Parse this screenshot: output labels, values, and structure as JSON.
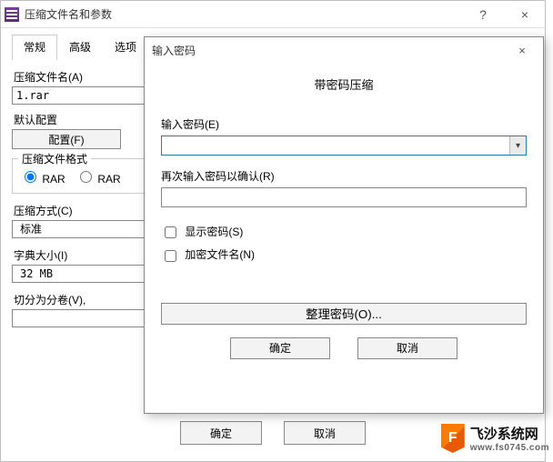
{
  "main": {
    "title": "压缩文件名和参数",
    "help": "?",
    "close": "×",
    "tabs": [
      "常规",
      "高级",
      "选项"
    ],
    "filename_label": "压缩文件名(A)",
    "filename_value": "1.rar",
    "default_config_label": "默认配置",
    "config_button": "配置(F)",
    "format_legend": "压缩文件格式",
    "format_rar": "RAR",
    "format_rar_alt": "RAR",
    "method_label": "压缩方式(C)",
    "method_value": "标准",
    "dict_label": "字典大小(I)",
    "dict_value": "32 MB",
    "split_label": "切分为分卷(V), ",
    "ok": "确定",
    "cancel": "取消"
  },
  "modal": {
    "title": "输入密码",
    "close": "×",
    "heading": "带密码压缩",
    "pwd_label": "输入密码(E)",
    "pwd_value": "",
    "confirm_label": "再次输入密码以确认(R)",
    "confirm_value": "",
    "show_pwd": "显示密码(S)",
    "enc_names": "加密文件名(N)",
    "manage": "整理密码(O)...",
    "ok": "确定",
    "cancel": "取消"
  },
  "watermark": {
    "flag": "F",
    "line1": "飞沙系统网",
    "line2": "www.fs0745.com"
  }
}
